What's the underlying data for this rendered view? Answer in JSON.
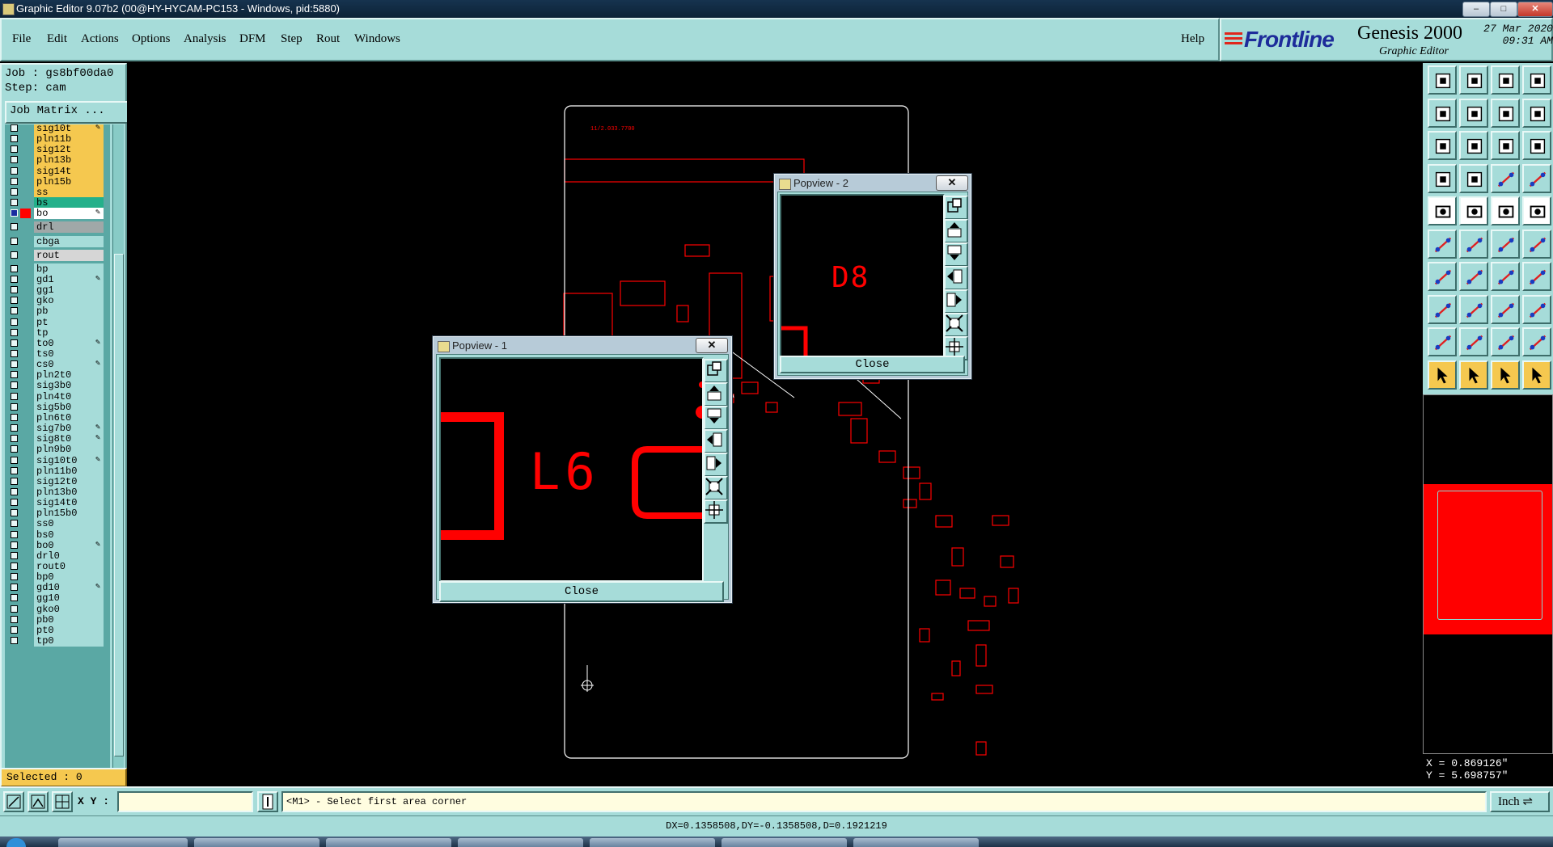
{
  "window": {
    "title": "Graphic Editor 9.07b2 (00@HY-HYCAM-PC153 - Windows, pid:5880)",
    "min": "–",
    "max": "□",
    "close": "✕"
  },
  "menu": [
    {
      "label": "File"
    },
    {
      "label": "Edit"
    },
    {
      "label": "Actions"
    },
    {
      "label": "Options"
    },
    {
      "label": "Analysis"
    },
    {
      "label": "DFM"
    },
    {
      "label": "Step"
    },
    {
      "label": "Rout"
    },
    {
      "label": "Windows"
    }
  ],
  "help_label": "Help",
  "brand": {
    "logo": "Frontline",
    "product": "Genesis 2000",
    "subtitle": "Graphic Editor",
    "date": "27 Mar 2020",
    "time": "09:31 AM"
  },
  "job": {
    "job_line": "Job : gs8bf00da0",
    "step_line": "Step: cam",
    "matrix_button": "Job Matrix ..."
  },
  "layers": [
    {
      "name": "sig10t",
      "color": "#f5c84f",
      "tick": true
    },
    {
      "name": "pln11b",
      "color": "#f5c84f"
    },
    {
      "name": "sig12t",
      "color": "#f5c84f"
    },
    {
      "name": "pln13b",
      "color": "#f5c84f"
    },
    {
      "name": "sig14t",
      "color": "#f5c84f"
    },
    {
      "name": "pln15b",
      "color": "#f5c84f"
    },
    {
      "name": "ss",
      "color": "#f5c84f"
    },
    {
      "name": "bs",
      "color": "#24b08a"
    },
    {
      "name": "bo",
      "color": "#ffffff",
      "tick": true,
      "active": true
    },
    {
      "gap": true
    },
    {
      "name": "drl",
      "color": "#a0a8a8"
    },
    {
      "gap": true
    },
    {
      "name": "cbga",
      "color": "#a6dcd9"
    },
    {
      "gap": true
    },
    {
      "name": "rout",
      "color": "#d6d6d6"
    },
    {
      "gap": true
    },
    {
      "name": "bp",
      "color": "#a6dcd9"
    },
    {
      "name": "gd1",
      "color": "#a6dcd9",
      "tick": true
    },
    {
      "name": "gg1",
      "color": "#a6dcd9"
    },
    {
      "name": "gko",
      "color": "#a6dcd9"
    },
    {
      "name": "pb",
      "color": "#a6dcd9"
    },
    {
      "name": "pt",
      "color": "#a6dcd9"
    },
    {
      "name": "tp",
      "color": "#a6dcd9"
    },
    {
      "name": "to0",
      "color": "#a6dcd9",
      "tick": true
    },
    {
      "name": "ts0",
      "color": "#a6dcd9"
    },
    {
      "name": "cs0",
      "color": "#a6dcd9",
      "tick": true
    },
    {
      "name": "pln2t0",
      "color": "#a6dcd9"
    },
    {
      "name": "sig3b0",
      "color": "#a6dcd9"
    },
    {
      "name": "pln4t0",
      "color": "#a6dcd9"
    },
    {
      "name": "sig5b0",
      "color": "#a6dcd9"
    },
    {
      "name": "pln6t0",
      "color": "#a6dcd9"
    },
    {
      "name": "sig7b0",
      "color": "#a6dcd9",
      "tick": true
    },
    {
      "name": "sig8t0",
      "color": "#a6dcd9",
      "tick": true
    },
    {
      "name": "pln9b0",
      "color": "#a6dcd9"
    },
    {
      "name": "sig10t0",
      "color": "#a6dcd9",
      "tick": true
    },
    {
      "name": "pln11b0",
      "color": "#a6dcd9"
    },
    {
      "name": "sig12t0",
      "color": "#a6dcd9"
    },
    {
      "name": "pln13b0",
      "color": "#a6dcd9"
    },
    {
      "name": "sig14t0",
      "color": "#a6dcd9"
    },
    {
      "name": "pln15b0",
      "color": "#a6dcd9"
    },
    {
      "name": "ss0",
      "color": "#a6dcd9"
    },
    {
      "name": "bs0",
      "color": "#a6dcd9"
    },
    {
      "name": "bo0",
      "color": "#a6dcd9",
      "tick": true
    },
    {
      "name": "drl0",
      "color": "#a6dcd9"
    },
    {
      "name": "rout0",
      "color": "#a6dcd9"
    },
    {
      "name": "bp0",
      "color": "#a6dcd9"
    },
    {
      "name": "gd10",
      "color": "#a6dcd9",
      "tick": true
    },
    {
      "name": "gg10",
      "color": "#a6dcd9"
    },
    {
      "name": "gko0",
      "color": "#a6dcd9"
    },
    {
      "name": "pb0",
      "color": "#a6dcd9"
    },
    {
      "name": "pt0",
      "color": "#a6dcd9"
    },
    {
      "name": "tp0",
      "color": "#a6dcd9"
    }
  ],
  "selected_label": "Selected : 0",
  "coords": {
    "x": "X = 0.869126\"",
    "y": "Y = 5.698757\""
  },
  "bottom": {
    "xy_label": "X Y :",
    "xy_value": "",
    "prompt": "<M1> - Select first area corner",
    "unit": "Inch ⇌"
  },
  "status": "DX=0.1358508,DY=-0.1358508,D=0.1921219",
  "popview1": {
    "title": "Popview - 1",
    "label": "L6",
    "close": "Close"
  },
  "popview2": {
    "title": "Popview - 2",
    "label": "D8",
    "close": "Close"
  },
  "colors": {
    "accent": "#a6dcd9",
    "pcb_red": "#ff0000",
    "selected_bg": "#f5c84f"
  }
}
